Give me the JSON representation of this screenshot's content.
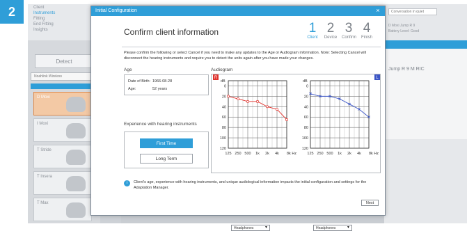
{
  "step_badge": "2",
  "app": {
    "nav": [
      "Client",
      "Instruments",
      "Fitting",
      "End Fitting",
      "Insights"
    ],
    "detect_label": "Detect",
    "device_select": "Noahlink Wireless",
    "families": [
      "D Moxi",
      "I Moxi",
      "T Stride",
      "T Insera",
      "T Max",
      "Moxi"
    ],
    "right_top": "Conversation in quiet",
    "right_notes": [
      "D Moxi Jump R 9",
      "Battery Level: Good"
    ],
    "right_title": "Jump R 9 M RIC"
  },
  "dialog": {
    "title": "Initial Configuration",
    "heading": "Confirm client information",
    "steps": [
      {
        "num": "1",
        "label": "Client"
      },
      {
        "num": "2",
        "label": "Device"
      },
      {
        "num": "3",
        "label": "Confirm"
      },
      {
        "num": "4",
        "label": "Finish"
      }
    ],
    "instructions": "Please confirm the following or select Cancel if you need to make any updates to the Age or Audiogram information. Note: Selecting Cancel will disconnect the hearing instruments and require you to detect the units again after you have made your changes.",
    "age": {
      "label": "Age",
      "dob_label": "Date of Birth:",
      "dob_value": "1966-08-28",
      "age_label": "Age:",
      "age_value": "52 years"
    },
    "experience": {
      "label": "Experience with hearing instruments",
      "first_time": "First Time",
      "long_term": "Long Term"
    },
    "audiogram": {
      "label": "Audiogram",
      "db_label": "dB",
      "y_ticks": [
        "-10",
        "0",
        "20",
        "40",
        "60",
        "80",
        "100",
        "120"
      ],
      "x_ticks": [
        "125",
        "250",
        "500",
        "1k",
        "2k",
        "4k",
        "8k Hz"
      ],
      "right_badge": "R",
      "left_badge": "L",
      "right_color": "#e0322c",
      "left_color": "#3b55c6",
      "transducer_right": "Headphones",
      "transducer_left": "Headphones"
    },
    "info": "Client's age, experience with hearing instruments, and unique audiological information impacts the initial configuration and settings for the Adaptation Manager.",
    "next_label": "Next"
  },
  "chart_data": [
    {
      "type": "line",
      "name": "Right ear audiogram",
      "x": [
        "125",
        "250",
        "500",
        "1k",
        "2k",
        "4k",
        "8k"
      ],
      "series": [
        {
          "name": "Right",
          "values": [
            20,
            25,
            30,
            30,
            40,
            45,
            65
          ]
        }
      ],
      "ylim": [
        -10,
        120
      ],
      "y_inverted": true,
      "ylabel": "dB",
      "xlabel": "Hz"
    },
    {
      "type": "line",
      "name": "Left ear audiogram",
      "x": [
        "125",
        "250",
        "500",
        "1k",
        "2k",
        "4k",
        "8k"
      ],
      "series": [
        {
          "name": "Left",
          "values": [
            15,
            20,
            20,
            25,
            35,
            45,
            60
          ]
        }
      ],
      "ylim": [
        -10,
        120
      ],
      "y_inverted": true,
      "ylabel": "dB",
      "xlabel": "Hz"
    }
  ]
}
